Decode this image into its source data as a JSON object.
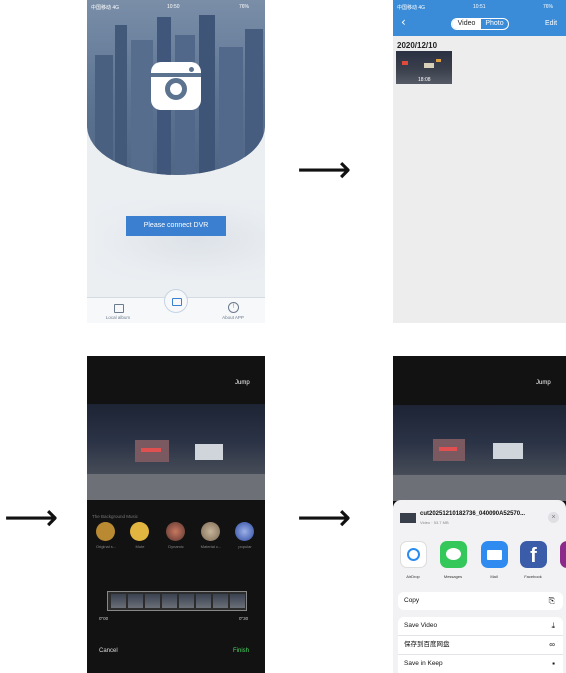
{
  "screen1": {
    "status": {
      "carrier": "中国移动 4G",
      "time": "10:50",
      "battery": "76%"
    },
    "connect_label": "Please connect DVR",
    "tabs": {
      "local_album": "Local album",
      "about_app": "About APP"
    }
  },
  "screen2": {
    "status": {
      "carrier": "中国移动 4G",
      "time": "10:51",
      "battery": "76%"
    },
    "back_glyph": "‹",
    "tab_video": "Video",
    "tab_photo": "Photo",
    "edit_label": "Edit",
    "date_header": "2020/12/10",
    "thumb_time": "18:08"
  },
  "screen3": {
    "jump_label": "Jump",
    "music_section_title": "The Background Music",
    "music_items": [
      "Original s...",
      "Mute",
      "Dynamic",
      "Material c...",
      "popular"
    ],
    "time_start": "0\"00",
    "time_end": "0\"30",
    "cancel_label": "Cancel",
    "finish_label": "Finish"
  },
  "screen4": {
    "jump_label": "Jump",
    "file_name": "cut20251210182736_040090A52570...",
    "file_meta": "Video · 53.7 MB",
    "apps": [
      "AirDrop",
      "Messages",
      "Mail",
      "Facebook"
    ],
    "actions": [
      "Copy",
      "Save Video",
      "保存到百度网盘",
      "Save in Keep"
    ]
  },
  "colors": {
    "accent_blue": "#3a8cd8",
    "finish_green": "#4cd964",
    "music_gold": "#c9a24a"
  }
}
